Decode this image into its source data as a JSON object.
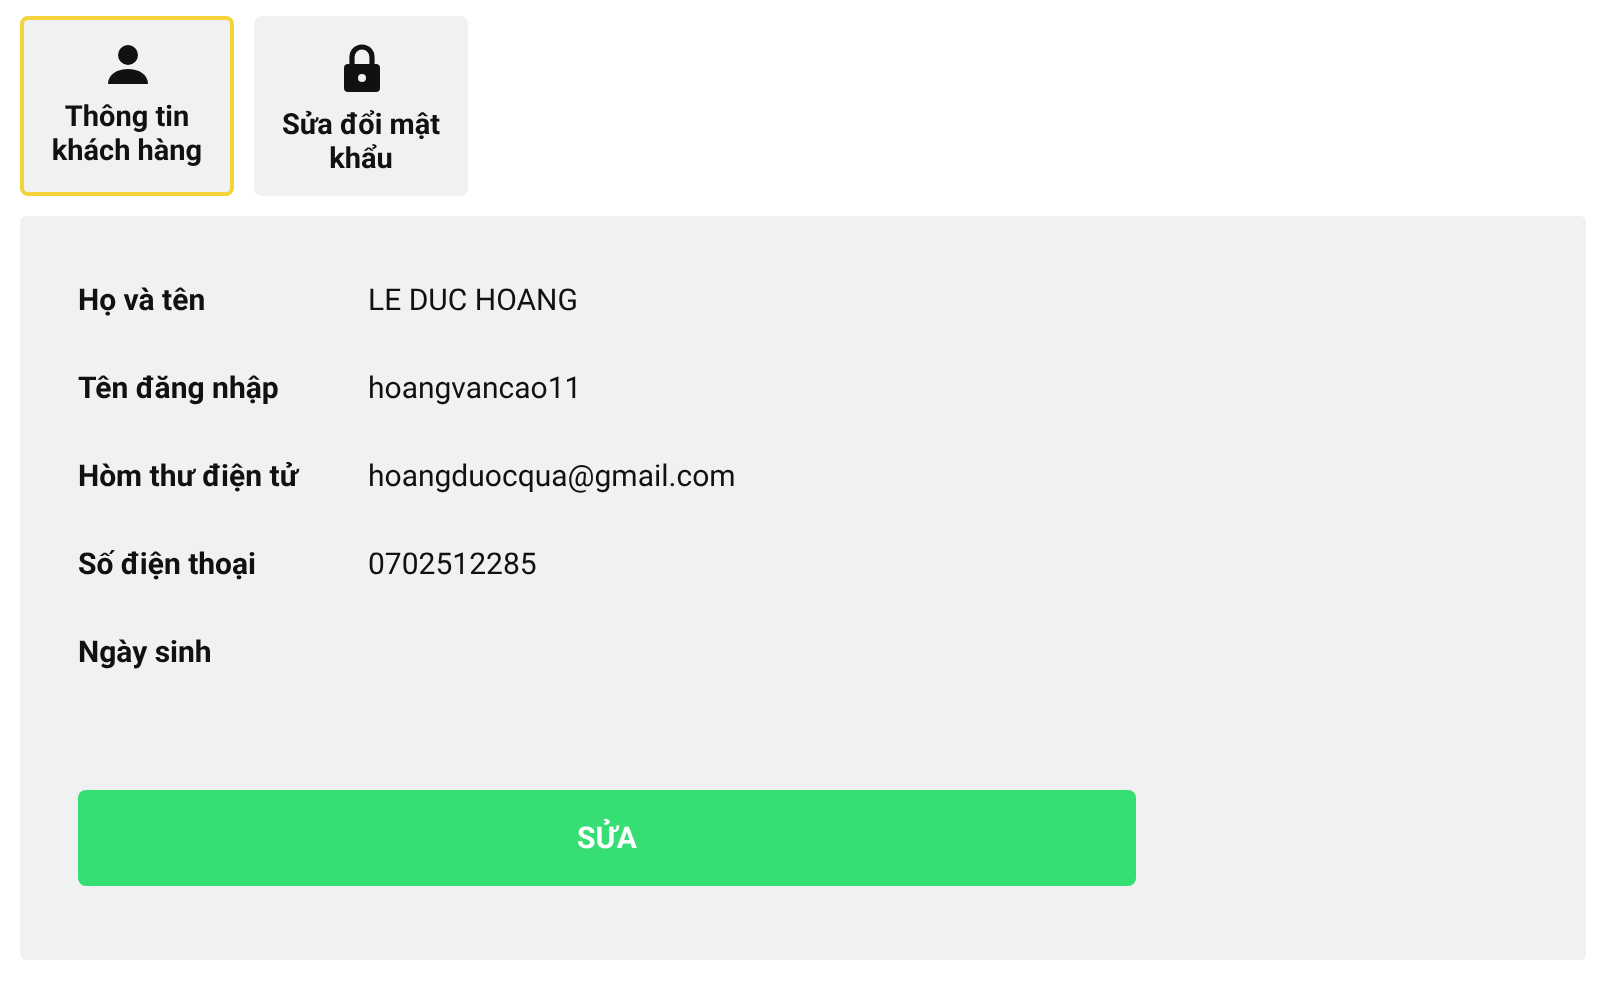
{
  "tabs": [
    {
      "kind": "person",
      "label": "Thông tin khách hàng",
      "selected": true
    },
    {
      "kind": "lock",
      "label": "Sửa đổi mật khẩu",
      "selected": false
    }
  ],
  "fields": [
    {
      "label": "Họ và tên",
      "value": "LE DUC HOANG"
    },
    {
      "label": "Tên đăng nhập",
      "value": "hoangvancao11"
    },
    {
      "label": "Hòm thư điện tử",
      "value": "hoangduocqua@gmail.com"
    },
    {
      "label": "Số điện thoại",
      "value": "0702512285"
    },
    {
      "label": "Ngày sinh"
    }
  ],
  "edit_button": "SỬA"
}
